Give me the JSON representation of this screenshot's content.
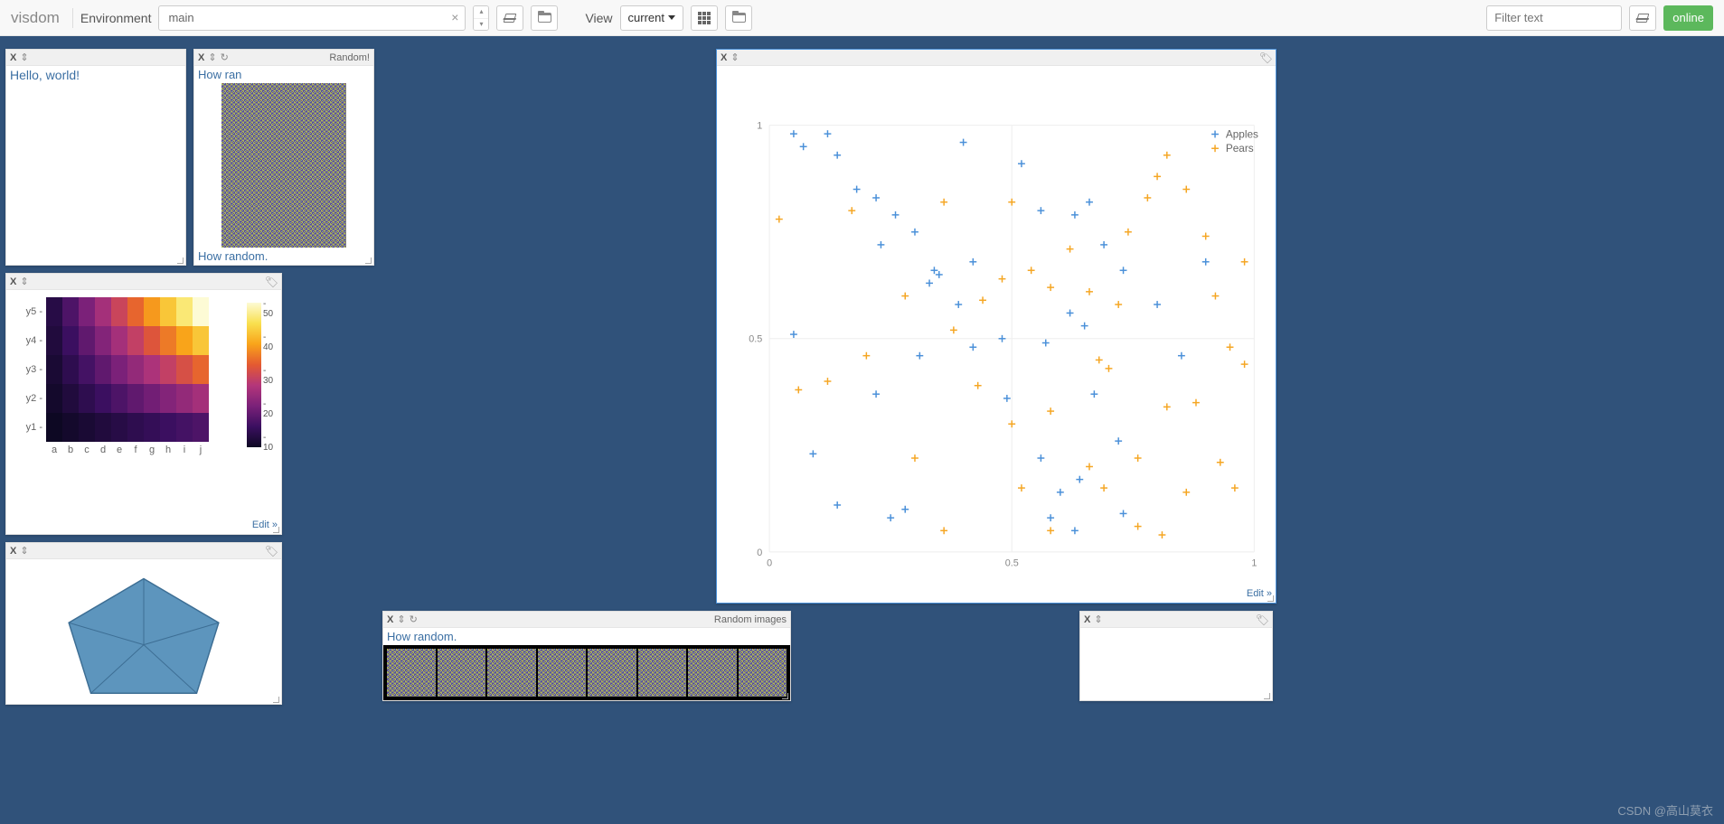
{
  "toolbar": {
    "brand": "visdom",
    "env_label": "Environment",
    "env_value": "main",
    "view_label": "View",
    "view_value": "current",
    "filter_placeholder": "Filter text",
    "status": "online"
  },
  "panes": {
    "hello": {
      "content": "Hello, world!"
    },
    "random": {
      "title": "Random!",
      "top_caption": "How ran",
      "bottom_caption": "How random."
    },
    "heatmap": {
      "edit": "Edit »"
    },
    "scatter": {
      "edit": "Edit »"
    },
    "random_images": {
      "title": "Random images",
      "caption": "How random."
    }
  },
  "chart_data": [
    {
      "type": "scatter",
      "name": "apples-pears-scatter",
      "xlim": [
        0,
        1
      ],
      "ylim": [
        0,
        1
      ],
      "xticks": [
        0,
        0.5,
        1
      ],
      "yticks": [
        0,
        0.5,
        1
      ],
      "legend": [
        "Apples",
        "Pears"
      ],
      "series": [
        {
          "name": "Apples",
          "color": "#4a90d9",
          "points": [
            [
              0.05,
              0.98
            ],
            [
              0.07,
              0.95
            ],
            [
              0.12,
              0.98
            ],
            [
              0.14,
              0.93
            ],
            [
              0.18,
              0.85
            ],
            [
              0.22,
              0.83
            ],
            [
              0.26,
              0.79
            ],
            [
              0.23,
              0.72
            ],
            [
              0.3,
              0.75
            ],
            [
              0.4,
              0.96
            ],
            [
              0.33,
              0.63
            ],
            [
              0.34,
              0.66
            ],
            [
              0.35,
              0.65
            ],
            [
              0.39,
              0.58
            ],
            [
              0.42,
              0.68
            ],
            [
              0.52,
              0.91
            ],
            [
              0.56,
              0.8
            ],
            [
              0.63,
              0.79
            ],
            [
              0.66,
              0.82
            ],
            [
              0.69,
              0.72
            ],
            [
              0.73,
              0.66
            ],
            [
              0.42,
              0.48
            ],
            [
              0.48,
              0.5
            ],
            [
              0.57,
              0.49
            ],
            [
              0.62,
              0.56
            ],
            [
              0.65,
              0.53
            ],
            [
              0.05,
              0.51
            ],
            [
              0.09,
              0.23
            ],
            [
              0.22,
              0.37
            ],
            [
              0.31,
              0.46
            ],
            [
              0.49,
              0.36
            ],
            [
              0.56,
              0.22
            ],
            [
              0.6,
              0.14
            ],
            [
              0.63,
              0.05
            ],
            [
              0.67,
              0.37
            ],
            [
              0.72,
              0.26
            ],
            [
              0.8,
              0.58
            ],
            [
              0.85,
              0.46
            ],
            [
              0.9,
              0.68
            ],
            [
              0.73,
              0.09
            ],
            [
              0.64,
              0.17
            ],
            [
              0.14,
              0.11
            ],
            [
              0.28,
              0.1
            ],
            [
              0.25,
              0.08
            ],
            [
              0.58,
              0.08
            ]
          ]
        },
        {
          "name": "Pears",
          "color": "#f5a623",
          "points": [
            [
              0.02,
              0.78
            ],
            [
              0.17,
              0.8
            ],
            [
              0.28,
              0.6
            ],
            [
              0.2,
              0.46
            ],
            [
              0.06,
              0.38
            ],
            [
              0.36,
              0.82
            ],
            [
              0.38,
              0.52
            ],
            [
              0.44,
              0.59
            ],
            [
              0.48,
              0.64
            ],
            [
              0.54,
              0.66
            ],
            [
              0.5,
              0.82
            ],
            [
              0.58,
              0.62
            ],
            [
              0.62,
              0.71
            ],
            [
              0.66,
              0.61
            ],
            [
              0.68,
              0.45
            ],
            [
              0.72,
              0.58
            ],
            [
              0.74,
              0.75
            ],
            [
              0.78,
              0.83
            ],
            [
              0.8,
              0.88
            ],
            [
              0.82,
              0.93
            ],
            [
              0.86,
              0.85
            ],
            [
              0.9,
              0.74
            ],
            [
              0.92,
              0.6
            ],
            [
              0.95,
              0.48
            ],
            [
              0.98,
              0.68
            ],
            [
              0.98,
              0.44
            ],
            [
              0.12,
              0.4
            ],
            [
              0.3,
              0.22
            ],
            [
              0.36,
              0.05
            ],
            [
              0.43,
              0.39
            ],
            [
              0.5,
              0.3
            ],
            [
              0.52,
              0.15
            ],
            [
              0.58,
              0.33
            ],
            [
              0.58,
              0.05
            ],
            [
              0.66,
              0.2
            ],
            [
              0.7,
              0.43
            ],
            [
              0.76,
              0.22
            ],
            [
              0.82,
              0.34
            ],
            [
              0.86,
              0.14
            ],
            [
              0.88,
              0.35
            ],
            [
              0.93,
              0.21
            ],
            [
              0.96,
              0.15
            ],
            [
              0.76,
              0.06
            ],
            [
              0.81,
              0.04
            ],
            [
              0.69,
              0.15
            ]
          ]
        }
      ]
    },
    {
      "type": "heatmap",
      "name": "multiplication-heatmap",
      "x_categories": [
        "a",
        "b",
        "c",
        "d",
        "e",
        "f",
        "g",
        "h",
        "i",
        "j"
      ],
      "y_categories": [
        "y1",
        "y2",
        "y3",
        "y4",
        "y5"
      ],
      "values": [
        [
          1,
          2,
          3,
          4,
          5,
          6,
          7,
          8,
          9,
          10
        ],
        [
          2,
          4,
          6,
          8,
          10,
          12,
          14,
          16,
          18,
          20
        ],
        [
          3,
          6,
          9,
          12,
          15,
          18,
          21,
          24,
          27,
          30
        ],
        [
          4,
          8,
          12,
          16,
          20,
          24,
          28,
          32,
          36,
          40
        ],
        [
          5,
          10,
          15,
          20,
          25,
          30,
          35,
          40,
          45,
          50
        ]
      ],
      "colorbar_ticks": [
        50,
        40,
        30,
        20,
        10
      ],
      "cmin": 1,
      "cmax": 50
    }
  ],
  "watermark": "CSDN @高山莫衣"
}
